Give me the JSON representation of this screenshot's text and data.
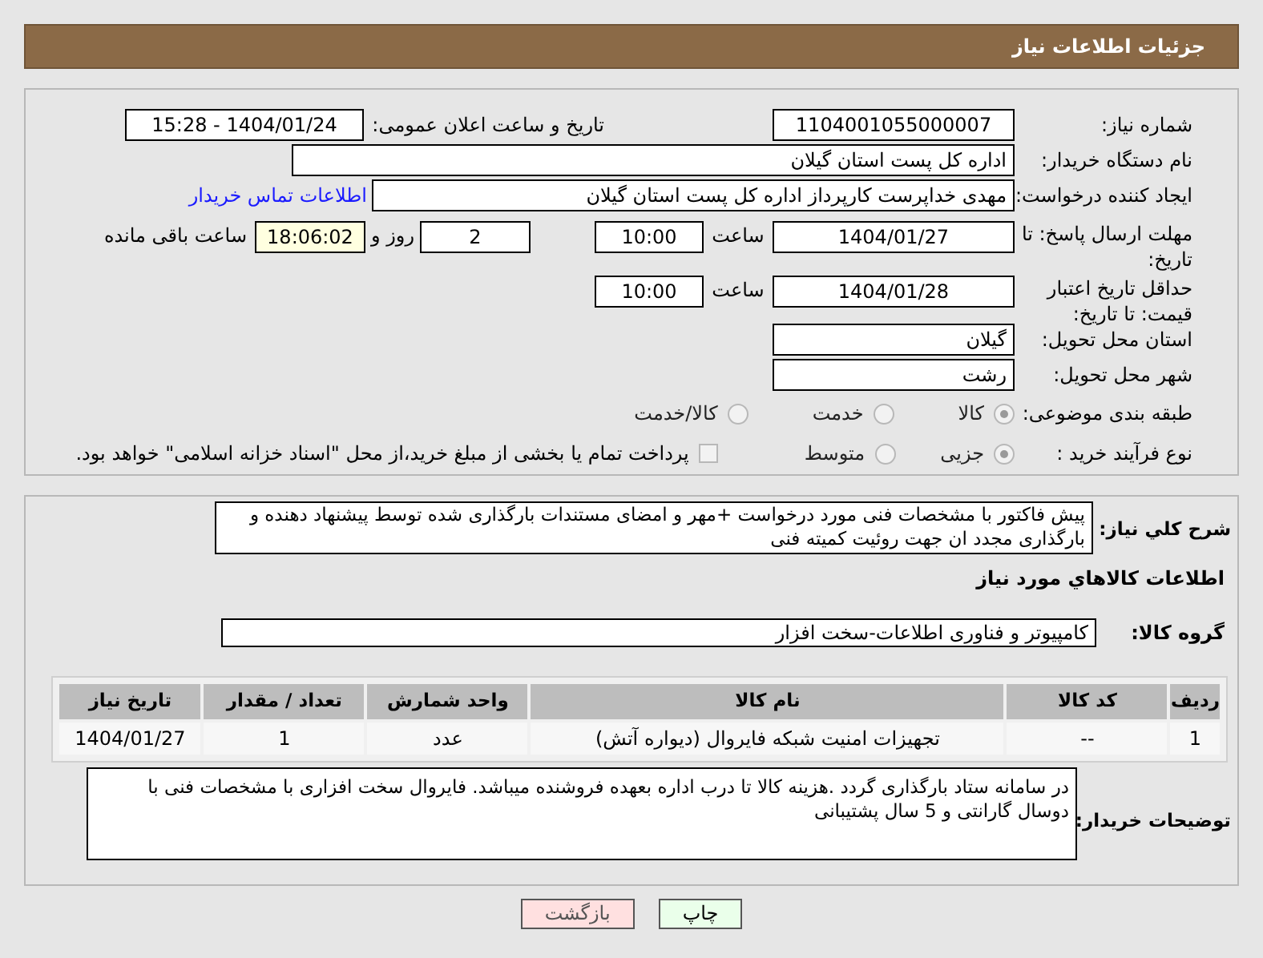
{
  "header": {
    "title": "جزئیات اطلاعات نیاز"
  },
  "need_number": {
    "label": "شماره نیاز:",
    "value": "1104001055000007"
  },
  "announce": {
    "label": "تاریخ و ساعت اعلان عمومی:",
    "value": "1404/01/24 - 15:28"
  },
  "buyer_org": {
    "label": "نام دستگاه خریدار:",
    "value": "اداره کل پست استان گیلان"
  },
  "requester": {
    "label": "ایجاد کننده درخواست:",
    "value": "مهدی  خداپرست  کارپرداز  اداره کل پست استان گیلان",
    "link": "اطلاعات تماس خریدار"
  },
  "deadline": {
    "label": "مهلت ارسال پاسخ: تا تاریخ:",
    "date": "1404/01/27",
    "time_label": "ساعت",
    "time": "10:00",
    "days": "2",
    "days_label": "روز و",
    "remaining": "18:06:02",
    "remaining_label": "ساعت باقی مانده"
  },
  "price_validity": {
    "label": "حداقل تاریخ اعتبار قیمت: تا تاریخ:",
    "date": "1404/01/28",
    "time_label": "ساعت",
    "time": "10:00"
  },
  "province": {
    "label": "استان محل تحویل:",
    "value": "گیلان"
  },
  "city": {
    "label": "شهر محل تحویل:",
    "value": "رشت"
  },
  "category": {
    "label": "طبقه بندی موضوعی:",
    "options": [
      {
        "label": "کالا",
        "selected": true
      },
      {
        "label": "خدمت",
        "selected": false
      },
      {
        "label": "کالا/خدمت",
        "selected": false
      }
    ]
  },
  "process": {
    "label": "نوع فرآیند خرید :",
    "options": [
      {
        "label": "جزیی",
        "selected": true
      },
      {
        "label": "متوسط",
        "selected": false
      }
    ],
    "payment": {
      "label": "پرداخت تمام یا بخشی از مبلغ خرید،از محل \"اسناد خزانه اسلامی\" خواهد بود.",
      "checked": false
    }
  },
  "description": {
    "label": "شرح کلي نياز:",
    "value": "پیش فاکتور با مشخصات فنی مورد درخواست +مهر و امضای مستندات بارگذاری شده توسط پیشنهاد دهنده و بارگذاری مجدد ان جهت روئیت کمیته فنی"
  },
  "goods_heading": "اطلاعات کالاهاي مورد نياز",
  "goods_group": {
    "label": "گروه کالا:",
    "value": "کامپیوتر و فناوری اطلاعات-سخت افزار"
  },
  "table": {
    "columns": [
      "ردیف",
      "کد کالا",
      "نام کالا",
      "واحد شمارش",
      "تعداد / مقدار",
      "تاریخ نیاز"
    ],
    "rows": [
      [
        "1",
        "--",
        "تجهیزات امنیت شبکه فایروال (دیواره آتش)",
        "عدد",
        "1",
        "1404/01/27"
      ]
    ]
  },
  "buyer_notes": {
    "label": "توضیحات خریدار:",
    "value": "در سامانه ستاد بارگذاری گردد .هزینه کالا تا درب اداره بعهده فروشنده میباشد. فایروال سخت افزاری با مشخصات فنی با دوسال گارانتی و 5 سال پشتیبانی"
  },
  "buttons": [
    {
      "label": "چاپ",
      "kind": "print"
    },
    {
      "label": "بازگشت",
      "kind": "back"
    }
  ]
}
